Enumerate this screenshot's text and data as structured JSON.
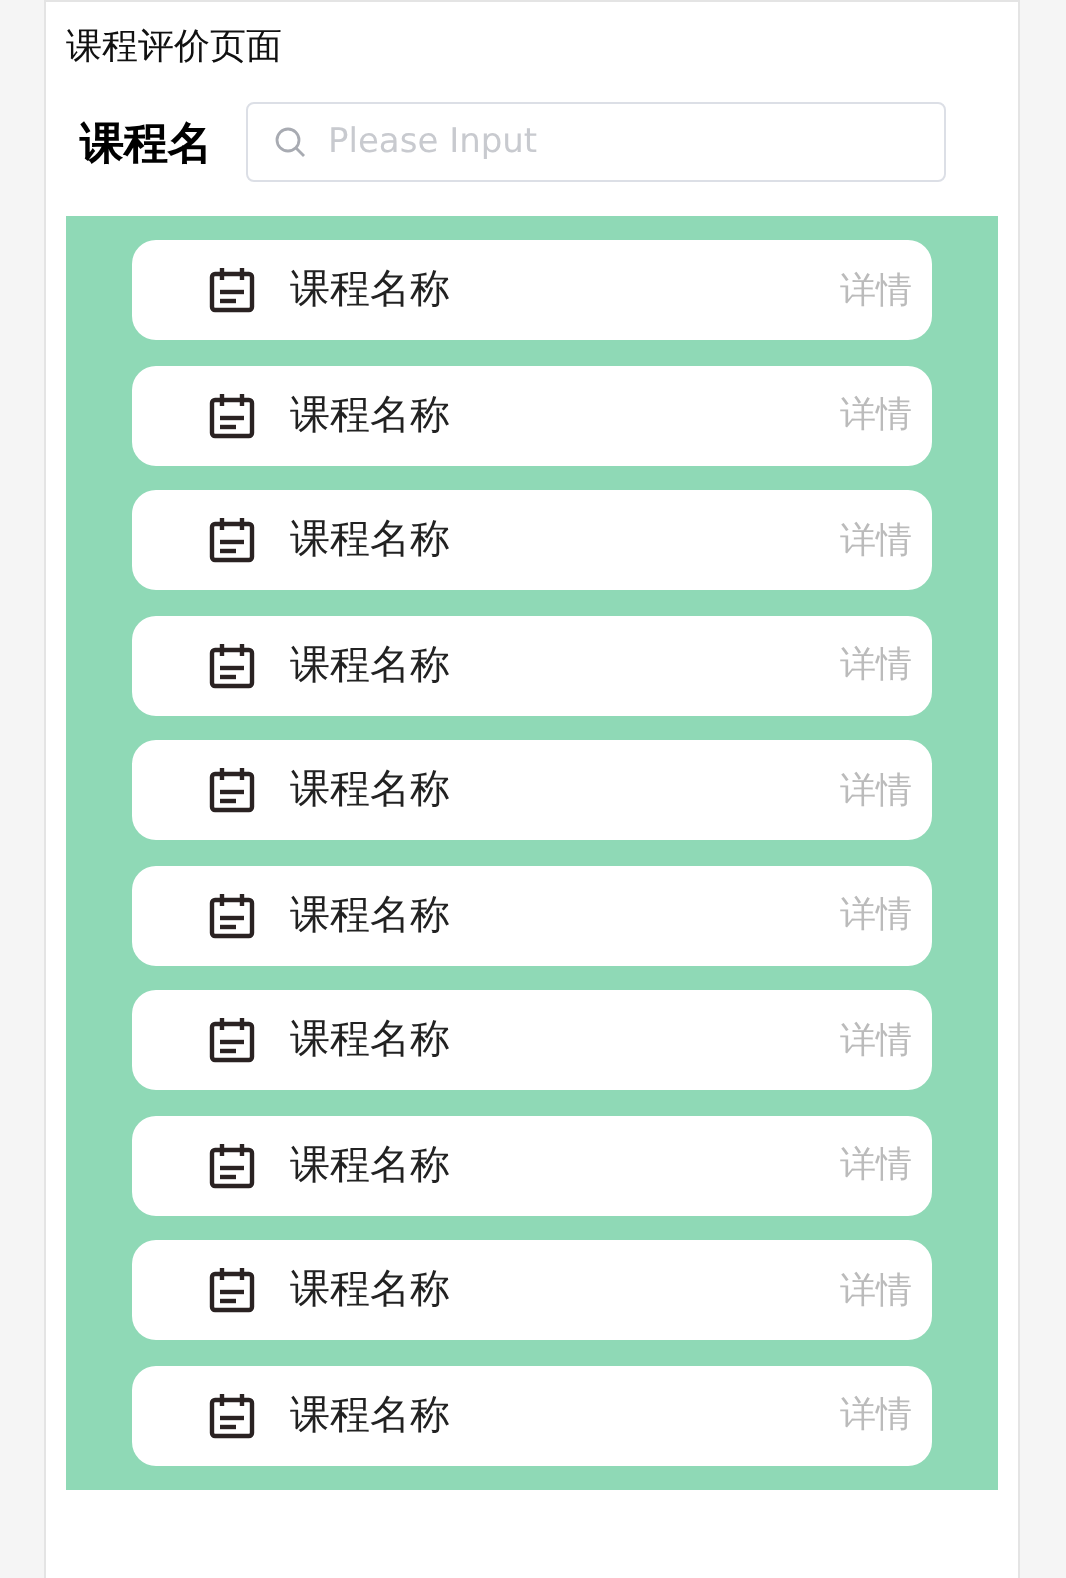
{
  "page": {
    "title": "课程评价页面"
  },
  "search": {
    "label": "课程名",
    "placeholder": "Please Input"
  },
  "courses": [
    {
      "name": "课程名称",
      "action": "详情"
    },
    {
      "name": "课程名称",
      "action": "详情"
    },
    {
      "name": "课程名称",
      "action": "详情"
    },
    {
      "name": "课程名称",
      "action": "详情"
    },
    {
      "name": "课程名称",
      "action": "详情"
    },
    {
      "name": "课程名称",
      "action": "详情"
    },
    {
      "name": "课程名称",
      "action": "详情"
    },
    {
      "name": "课程名称",
      "action": "详情"
    },
    {
      "name": "课程名称",
      "action": "详情"
    },
    {
      "name": "课程名称",
      "action": "详情"
    }
  ]
}
